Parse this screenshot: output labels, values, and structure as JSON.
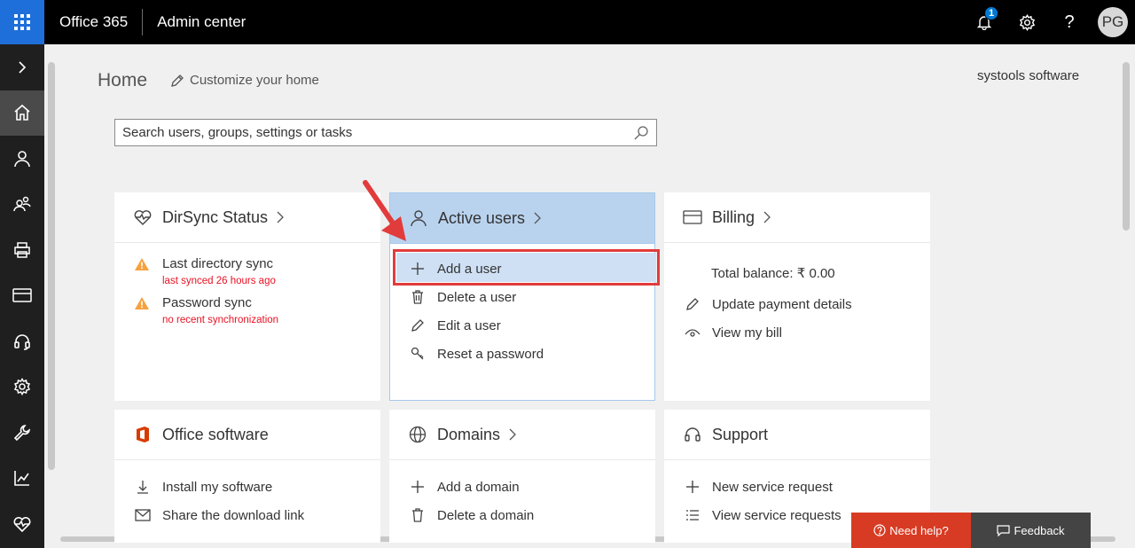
{
  "topbar": {
    "brand": "Office 365",
    "app_name": "Admin center",
    "notification_count": "1",
    "help_glyph": "?",
    "avatar_initials": "PG"
  },
  "header": {
    "title": "Home",
    "customize_label": "Customize your home",
    "org_name": "systools software"
  },
  "search": {
    "placeholder": "Search users, groups, settings or tasks"
  },
  "cards": {
    "dirsync": {
      "title": "DirSync Status",
      "items": [
        {
          "label": "Last directory sync",
          "status": "last synced 26 hours ago"
        },
        {
          "label": "Password sync",
          "status": "no recent synchronization"
        }
      ]
    },
    "active_users": {
      "title": "Active users",
      "items": [
        {
          "label": "Add a user",
          "icon": "plus-icon"
        },
        {
          "label": "Delete a user",
          "icon": "trash-icon"
        },
        {
          "label": "Edit a user",
          "icon": "pencil-icon"
        },
        {
          "label": "Reset a password",
          "icon": "key-icon"
        }
      ]
    },
    "billing": {
      "title": "Billing",
      "balance": "Total balance: ₹ 0.00",
      "items": [
        {
          "label": "Update payment details",
          "icon": "pencil-icon"
        },
        {
          "label": "View my bill",
          "icon": "eye-icon"
        }
      ]
    },
    "office_software": {
      "title": "Office software",
      "items": [
        {
          "label": "Install my software",
          "icon": "download-icon"
        },
        {
          "label": "Share the download link",
          "icon": "mail-icon"
        }
      ]
    },
    "domains": {
      "title": "Domains",
      "items": [
        {
          "label": "Add a domain",
          "icon": "plus-icon"
        },
        {
          "label": "Delete a domain",
          "icon": "trash-icon"
        }
      ]
    },
    "support": {
      "title": "Support",
      "items": [
        {
          "label": "New service request",
          "icon": "plus-icon"
        },
        {
          "label": "View service requests",
          "icon": "list-icon"
        }
      ]
    }
  },
  "footer": {
    "need_help": "Need help?",
    "feedback": "Feedback"
  },
  "colors": {
    "accent": "#1e6fd9",
    "highlight_header": "#b9d3ef",
    "warning": "#f7a13e",
    "error_text": "#e81123",
    "annotation_red": "#e23b3b",
    "need_help_bg": "#d83b23"
  }
}
